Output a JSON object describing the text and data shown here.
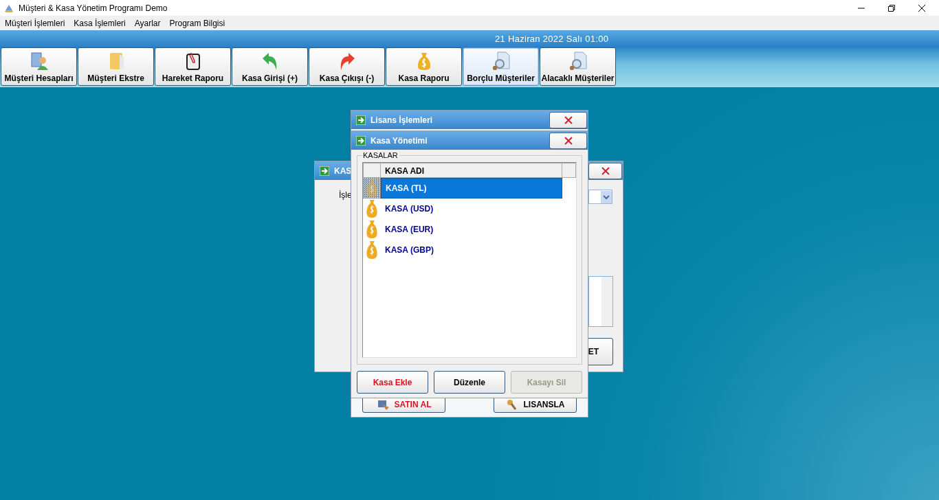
{
  "window": {
    "title": "Müşteri & Kasa Yönetim Programı Demo"
  },
  "menu": [
    {
      "label": "Müşteri İşlemleri"
    },
    {
      "label": "Kasa İşlemleri"
    },
    {
      "label": "Ayarlar"
    },
    {
      "label": "Program Bilgisi"
    }
  ],
  "date": "21 Haziran 2022 Salı 01:00",
  "toolbar": [
    {
      "label": "Müşteri Hesapları",
      "kind": "person",
      "selected": false
    },
    {
      "label": "Müşteri Ekstre",
      "kind": "folder",
      "selected": false
    },
    {
      "label": "Hareket Raporu",
      "kind": "clip",
      "selected": false
    },
    {
      "label": "Kasa Girişi (+)",
      "kind": "in",
      "selected": false
    },
    {
      "label": "Kasa Çıkışı (-)",
      "kind": "out",
      "selected": false
    },
    {
      "label": "Kasa Raporu",
      "kind": "bag",
      "selected": false
    },
    {
      "label": "Borçlu Müşteriler",
      "kind": "search",
      "selected": true
    },
    {
      "label": "Alacaklı Müşteriler",
      "kind": "search",
      "selected": false
    }
  ],
  "back_dialog": {
    "title": "KAS",
    "label": "İşle",
    "button": "ET"
  },
  "license_dialog": {
    "title": "Lisans İşlemleri",
    "buttons": [
      {
        "label": "SATIN AL",
        "kind": "buy"
      },
      {
        "label": "LISANSLA",
        "kind": "key"
      }
    ]
  },
  "kasa_dialog": {
    "title": "Kasa Yönetimi",
    "group": "KASALAR",
    "columns": [
      "KASA ADI"
    ],
    "rows": [
      {
        "name": "KASA (TL)",
        "selected": true
      },
      {
        "name": "KASA (USD)",
        "selected": false
      },
      {
        "name": "KASA (EUR)",
        "selected": false
      },
      {
        "name": "KASA (GBP)",
        "selected": false
      }
    ],
    "buttons": [
      {
        "label": "Kasa Ekle",
        "kind": "accent",
        "disabled": false
      },
      {
        "label": "Düzenle",
        "kind": "normal",
        "disabled": false
      },
      {
        "label": "Kasayı Sil",
        "kind": "normal",
        "disabled": true
      }
    ]
  }
}
